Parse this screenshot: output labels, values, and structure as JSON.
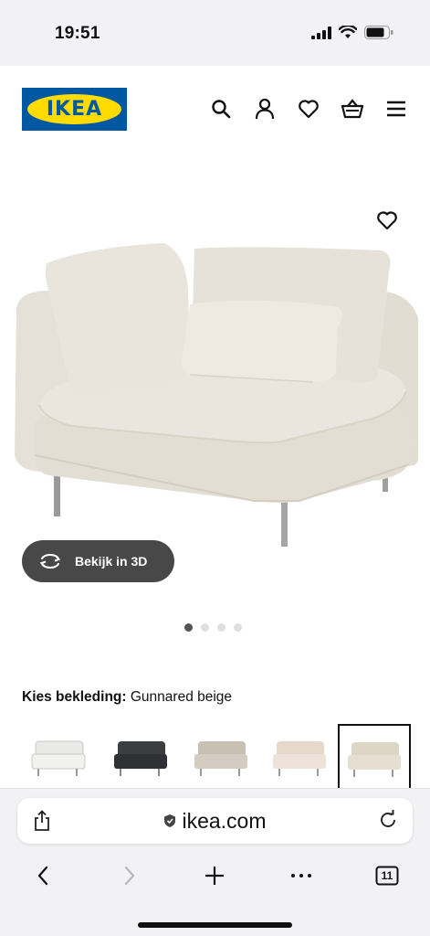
{
  "status_bar": {
    "time": "19:51"
  },
  "header": {
    "logo_text": "IKEA",
    "icons": [
      "search-icon",
      "user-icon",
      "heart-icon",
      "basket-icon",
      "menu-icon"
    ]
  },
  "product": {
    "view_3d_label": "Bekijk in 3D",
    "carousel_dots": 4,
    "carousel_active": 1
  },
  "upholstery": {
    "label": "Kies bekleding:",
    "value": "Gunnared beige",
    "swatches": [
      {
        "name": "white",
        "color": "#e9e9e6"
      },
      {
        "name": "dark grey",
        "color": "#3b3d40"
      },
      {
        "name": "grey beige",
        "color": "#c9c0b4"
      },
      {
        "name": "light beige pink",
        "color": "#e6d9cc"
      },
      {
        "name": "Gunnared beige",
        "color": "#ddd5c6",
        "selected": true
      }
    ]
  },
  "browser": {
    "url": "ikea.com",
    "tabs_count": "11"
  },
  "colors": {
    "ikea_blue": "#0058a3",
    "ikea_yellow": "#ffdb00",
    "button_dark": "#484848"
  }
}
